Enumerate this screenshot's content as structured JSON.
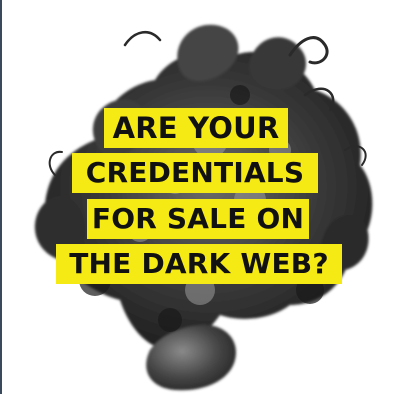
{
  "colors": {
    "highlight": "#f5ea14",
    "text": "#111111",
    "smoke": "#2a2a2a",
    "background": "#ffffff"
  },
  "headline": {
    "line1": "ARE YOUR",
    "line2": "CREDENTIALS",
    "line3": "FOR SALE ON",
    "line4": "THE DARK WEB?"
  }
}
